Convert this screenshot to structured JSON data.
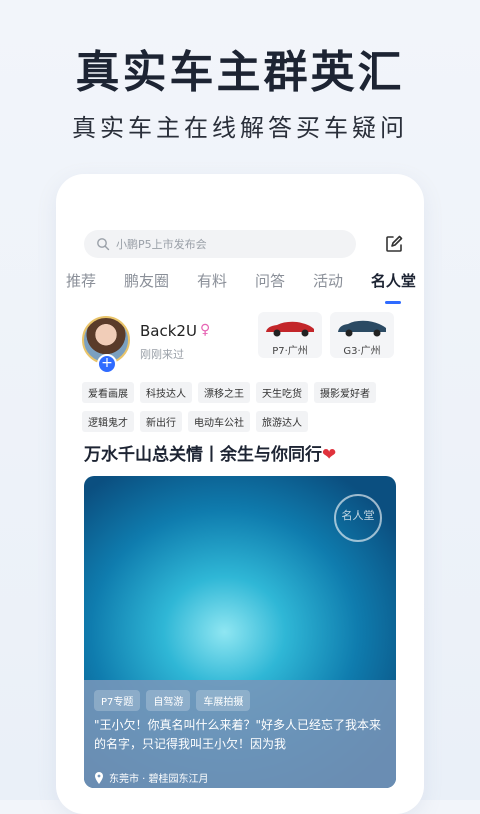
{
  "hero": {
    "title": "真实车主群英汇",
    "subtitle": "真实车主在线解答买车疑问"
  },
  "search": {
    "placeholder": "小鹏P5上市发布会"
  },
  "tabs": [
    "推荐",
    "鹏友圈",
    "有料",
    "问答",
    "活动",
    "名人堂"
  ],
  "active_tab": "名人堂",
  "profile": {
    "username": "Back2U",
    "gender_symbol": "♀",
    "last_seen": "刚刚来过",
    "cars": [
      {
        "label": "P7·广州",
        "color": "#c3262a"
      },
      {
        "label": "G3·广州",
        "color": "#2b4a63"
      }
    ]
  },
  "badges": {
    "row1": [
      "爱看画展",
      "科技达人",
      "漂移之王",
      "天生吃货",
      "摄影爱好者"
    ],
    "row2": [
      "逻辑鬼才",
      "新出行",
      "电动车公社",
      "旅游达人"
    ]
  },
  "post": {
    "title": "万水千山总关情丨余生与你同行",
    "heart": "❤",
    "watermark": "名人堂",
    "tags": [
      "P7专题",
      "自驾游",
      "车展拍摄"
    ],
    "excerpt": "\"王小欠！你真名叫什么来着？\"好多人已经忘了我本来的名字，只记得我叫王小欠！因为我",
    "location": "东莞市 · 碧桂园东江月"
  },
  "colors": {
    "accent": "#2f6bff",
    "avatar_border": "#e9c46a"
  }
}
